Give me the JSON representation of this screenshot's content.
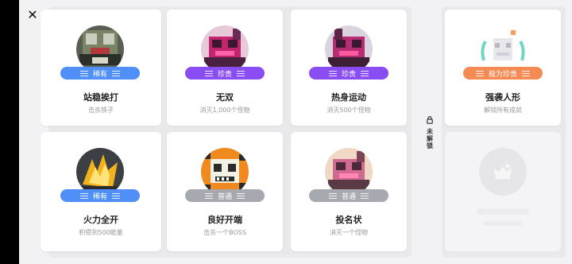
{
  "window": {
    "close_icon": "close-icon"
  },
  "cards": [
    {
      "title": "站稳挨打",
      "desc": "击杀铁子",
      "badge": "稀有",
      "badge_color": "#4f8ff7",
      "art": "skull"
    },
    {
      "title": "无双",
      "desc": "消灭1,000个怪物",
      "badge": "珍贵",
      "badge_color": "#8a4df3",
      "art": "pink-monster"
    },
    {
      "title": "热身运动",
      "desc": "消灭500个怪物",
      "badge": "珍贵",
      "badge_color": "#8a4df3",
      "art": "pink-monster"
    },
    {
      "title": "火力全开",
      "desc": "积攒到500能量",
      "badge": "稀有",
      "badge_color": "#4f8ff7",
      "art": "flame"
    },
    {
      "title": "良好开端",
      "desc": "击杀一个BOSS",
      "badge": "普通",
      "badge_color": "#a6a9b0",
      "art": "tiger-skull"
    },
    {
      "title": "投名状",
      "desc": "消灭一个怪物",
      "badge": "普通",
      "badge_color": "#a6a9b0",
      "art": "pink-monster-light"
    }
  ],
  "locked_section": {
    "label": "未解锁",
    "icon": "lock-icon",
    "card": {
      "title": "强袭人形",
      "desc": "解锁所有成就",
      "badge": "极为珍贵",
      "badge_color": "#f58a54",
      "art": "ghost-trophy"
    },
    "placeholder_icon": "trophy-placeholder-icon"
  }
}
